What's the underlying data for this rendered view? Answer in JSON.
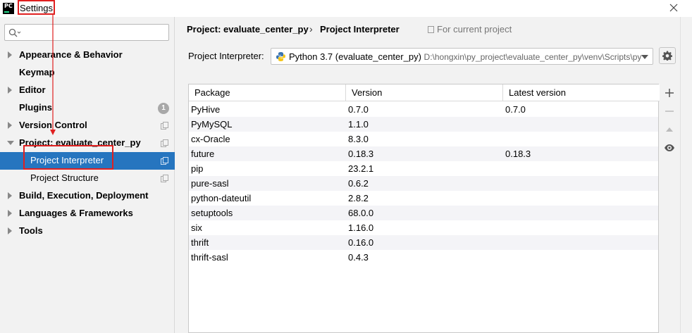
{
  "window": {
    "title": "Settings",
    "app_badge": "PC"
  },
  "search": {
    "value": "",
    "placeholder": ""
  },
  "sidebar": {
    "items": [
      {
        "label": "Appearance & Behavior"
      },
      {
        "label": "Keymap"
      },
      {
        "label": "Editor"
      },
      {
        "label": "Plugins",
        "badge": "1"
      },
      {
        "label": "Version Control"
      },
      {
        "label": "Project: evaluate_center_py"
      },
      {
        "label": "Project Interpreter"
      },
      {
        "label": "Project Structure"
      },
      {
        "label": "Build, Execution, Deployment"
      },
      {
        "label": "Languages & Frameworks"
      },
      {
        "label": "Tools"
      }
    ]
  },
  "breadcrumb": {
    "project": "Project: evaluate_center_py",
    "separator": "›",
    "page": "Project Interpreter",
    "scope": "For current project"
  },
  "interpreter": {
    "label": "Project Interpreter:",
    "name": "Python 3.7 (evaluate_center_py)",
    "path": "D:\\hongxin\\py_project\\evaluate_center_py\\venv\\Scripts\\py"
  },
  "table": {
    "headers": [
      "Package",
      "Version",
      "Latest version"
    ],
    "rows": [
      [
        "PyHive",
        "0.7.0",
        "0.7.0"
      ],
      [
        "PyMySQL",
        "1.1.0",
        ""
      ],
      [
        "cx-Oracle",
        "8.3.0",
        ""
      ],
      [
        "future",
        "0.18.3",
        "0.18.3"
      ],
      [
        "pip",
        "23.2.1",
        ""
      ],
      [
        "pure-sasl",
        "0.6.2",
        ""
      ],
      [
        "python-dateutil",
        "2.8.2",
        ""
      ],
      [
        "setuptools",
        "68.0.0",
        ""
      ],
      [
        "six",
        "1.16.0",
        ""
      ],
      [
        "thrift",
        "0.16.0",
        ""
      ],
      [
        "thrift-sasl",
        "0.4.3",
        ""
      ]
    ]
  },
  "tools": {
    "add": "+",
    "remove": "−"
  },
  "colors": {
    "selection": "#2675bf",
    "annotation": "#e02020"
  }
}
